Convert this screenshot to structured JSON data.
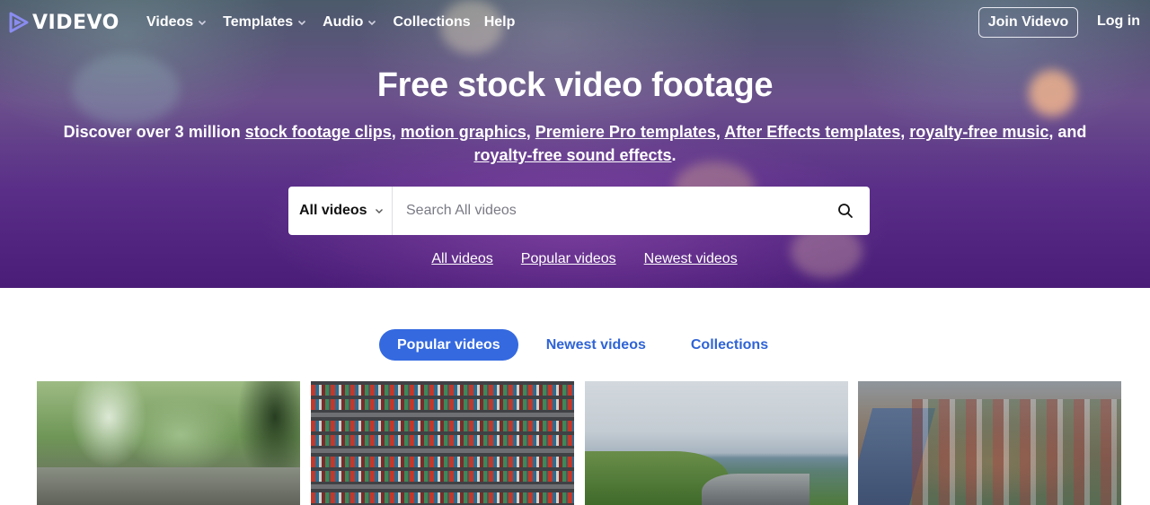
{
  "brand": {
    "name": "VIDEVO"
  },
  "nav": {
    "items": [
      {
        "label": "Videos",
        "has_dropdown": true
      },
      {
        "label": "Templates",
        "has_dropdown": true
      },
      {
        "label": "Audio",
        "has_dropdown": true
      },
      {
        "label": "Collections",
        "has_dropdown": false
      },
      {
        "label": "Help",
        "has_dropdown": false
      }
    ],
    "join_label": "Join Videvo",
    "login_label": "Log in"
  },
  "hero": {
    "title": "Free stock video footage",
    "subtitle": {
      "prefix": "Discover over 3 million ",
      "link1": "stock footage clips",
      "sep1": ", ",
      "link2": "motion graphics",
      "sep2": ", ",
      "link3": "Premiere Pro templates",
      "sep3": ", ",
      "link4": "After Effects templates",
      "sep4": ", ",
      "link5": "royalty-free music",
      "sep5": ", and ",
      "link6": "royalty-free sound effects",
      "suffix": "."
    }
  },
  "search": {
    "category": "All videos",
    "placeholder": "Search All videos",
    "value": ""
  },
  "quick_links": [
    "All videos",
    "Popular videos",
    "Newest videos"
  ],
  "tabs": [
    {
      "label": "Popular videos",
      "active": true
    },
    {
      "label": "Newest videos",
      "active": false
    },
    {
      "label": "Collections",
      "active": false
    }
  ],
  "thumbnails": [
    {
      "subject": "rain-on-ground-forest"
    },
    {
      "subject": "aerial-container-port"
    },
    {
      "subject": "coastline-cliffs-sea"
    },
    {
      "subject": "aerial-city-river"
    }
  ],
  "colors": {
    "accent": "#3469e0",
    "tab_text": "#2f64d6",
    "hero_top": "#4b5a6a",
    "hero_bottom": "#4a1d78"
  }
}
